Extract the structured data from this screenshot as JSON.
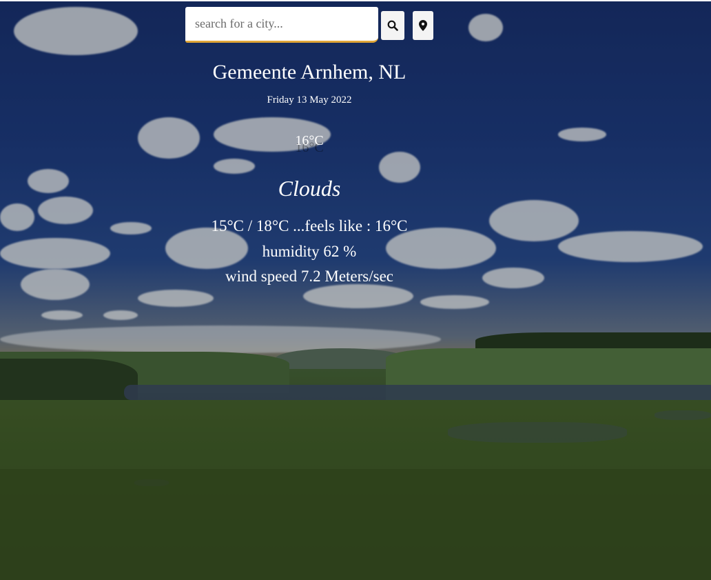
{
  "search": {
    "placeholder": "search for a city...",
    "value": ""
  },
  "icons": {
    "search_button": "search-icon",
    "location_button": "location-pin-icon"
  },
  "weather": {
    "city": "Gemeente Arnhem, NL",
    "date": "Friday 13 May 2022",
    "temperature": "16°C",
    "condition": "Clouds",
    "min_max_feels": "15°C / 18°C ...feels like : 16°C",
    "humidity": "humidity 62 %",
    "wind": "wind speed 7.2 Meters/sec"
  },
  "colors": {
    "accent_underline": "#e0a637",
    "text": "#ffffff"
  }
}
